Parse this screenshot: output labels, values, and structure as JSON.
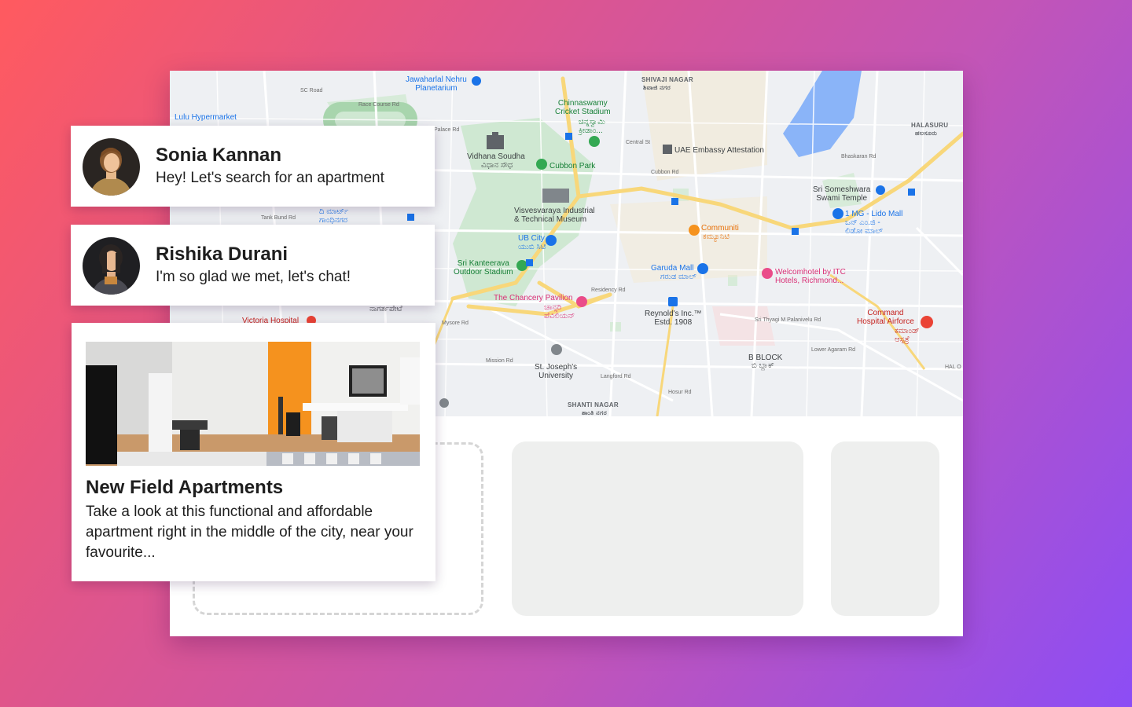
{
  "map": {
    "labels": {
      "nehru_planetarium": "Jawaharlal Nehru\nPlanetarium",
      "shivaji_nagar": "SHIVAJI NAGAR",
      "shivaji_nagar_kn": "ಶಿವಾಜಿ ನಗರ",
      "lulu": "Lulu Hypermarket",
      "chinnaswamy": "Chinnaswamy\nCricket Stadium",
      "chinnaswamy_kn": "ಚಿನ್ನಸ್ವಾಮಿ\nಕ್ರೀಡಾಂ...",
      "vidhana_soudha": "Vidhana Soudha",
      "vidhana_soudha_kn": "ವಿಧಾನ ಸೌಧ",
      "cubbon_park": "Cubbon Park",
      "uae_embassy": "UAE Embassy Attestation",
      "halasuru": "HALASURU",
      "halasuru_kn": "ಹಲಸೂರು",
      "someshwara": "Sri Someshwara\nSwami Temple",
      "lido_mall": "1 MG - Lido Mall",
      "lido_mall_kn": "ಒನ್ ಎಂ.ಜಿ -\nಲಿಡೋ ಮಾಲ್",
      "visvesvaraya": "Visvesvaraya Industrial\n& Technical Museum",
      "tank_bund": "Tank Bund Rd",
      "di_mart": "ದಿ ಮಾರ್ಟ್\nಗಾಂಧಿನಗರ",
      "communiti": "Communiti",
      "communiti_kn": "ಕಮ್ಯೂನಿಟಿ",
      "ub_city": "UB City",
      "ub_city_kn": "ಯುಬಿ ಸಿಟಿ",
      "kanteerava": "Sri Kanteerava\nOutdoor Stadium",
      "garuda": "Garuda Mall",
      "garuda_kn": "ಗರುಡ ಮಾಲ್",
      "welcomhotel": "Welcomhotel by ITC\nHotels, Richmond...",
      "chancery": "The Chancery Pavilion",
      "chancery_kn": "ಚಾನ್ಸರಿ\nಪೆವಿಲಿಯನ್",
      "reynolds": "Reynold's Inc.™\nEstd. 1908",
      "command_hospital": "Command\nHospital Airforce",
      "command_hospital_kn": "ಕಮಾಂಡ್\nಆಸ್ಪತ್ರೆ",
      "nagarapete": "ನಾಗರ್ತಪೇಟೆ",
      "victoria": "Victoria Hospital",
      "st_josephs": "St. Joseph's\nUniversity",
      "b_block": "B BLOCK",
      "b_block_kn": "ಬಿ ಬ್ಲಾಕ್",
      "shanti_nagar": "SHANTI NAGAR",
      "shanti_nagar_kn": "ಶಾಂತಿ ನಗರ",
      "race_course": "Race Course Rd",
      "sc_road": "SC Road",
      "cubbon_rd": "Cubbon Rd",
      "mission_rd": "Mission Rd",
      "langford_rd": "Langford Rd",
      "hosur_rd": "Hosur Rd",
      "residency_rd": "Residency Rd",
      "central_st": "Central St",
      "bhaskaran_rd": "Bhaskaran Rd",
      "palace_rd": "Palace Rd",
      "thyagi_rd": "Sri Thyagi M Palanivelu Rd",
      "agaram_rd": "Lower Agaram Rd",
      "mysore_rd": "Mysore Rd",
      "hal": "HAL O"
    }
  },
  "chats": [
    {
      "name": "Sonia Kannan",
      "message": "Hey! Let's search for an apartment"
    },
    {
      "name": "Rishika Durani",
      "message": "I'm so glad we met, let's chat!"
    }
  ],
  "listing": {
    "title": "New Field Apartments",
    "description": "Take a look at this functional and affordable apartment right in the middle of the city, near your favourite..."
  },
  "colors": {
    "gradient_start": "#ff5a5f",
    "gradient_end": "#8c4df5",
    "placeholder_grey": "#eeefee",
    "accent_orange": "#f5921e"
  }
}
